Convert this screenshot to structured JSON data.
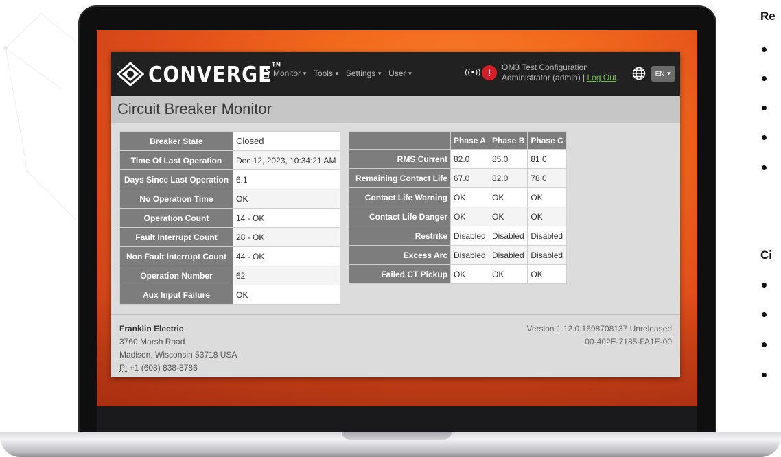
{
  "app": {
    "brand": "CONVERGE",
    "brand_tm": "TM",
    "nav": [
      {
        "label": "Monitor"
      },
      {
        "label": "Tools"
      },
      {
        "label": "Settings"
      },
      {
        "label": "User"
      }
    ],
    "config_name": "OM3 Test Configuration",
    "user_text": "Administrator (admin) |",
    "logout_label": "Log Out",
    "language": "EN",
    "accent_colors": {
      "navbar": "#212121",
      "alert": "#d51f26",
      "logout_link": "#6cc04a",
      "header_cell": "#7d7d7d"
    }
  },
  "page": {
    "title": "Circuit Breaker Monitor"
  },
  "breaker_table": {
    "rows": [
      {
        "label": "Breaker State",
        "value": "Closed"
      },
      {
        "label": "Time Of Last Operation",
        "value": "Dec 12, 2023, 10:34:21 AM"
      },
      {
        "label": "Days Since Last Operation",
        "value": "6.1"
      },
      {
        "label": "No Operation Time",
        "value": "OK"
      },
      {
        "label": "Operation Count",
        "value": "14 - OK"
      },
      {
        "label": "Fault Interrupt Count",
        "value": "28 - OK"
      },
      {
        "label": "Non Fault Interrupt Count",
        "value": "44 - OK"
      },
      {
        "label": "Operation Number",
        "value": "62"
      },
      {
        "label": "Aux Input Failure",
        "value": "OK"
      }
    ]
  },
  "phase_table": {
    "headers": [
      "Phase A",
      "Phase B",
      "Phase C"
    ],
    "rows": [
      {
        "label": "RMS Current",
        "values": [
          "82.0",
          "85.0",
          "81.0"
        ]
      },
      {
        "label": "Remaining Contact Life",
        "values": [
          "67.0",
          "82.0",
          "78.0"
        ]
      },
      {
        "label": "Contact Life Warning",
        "values": [
          "OK",
          "OK",
          "OK"
        ]
      },
      {
        "label": "Contact Life Danger",
        "values": [
          "OK",
          "OK",
          "OK"
        ]
      },
      {
        "label": "Restrike",
        "values": [
          "Disabled",
          "Disabled",
          "Disabled"
        ]
      },
      {
        "label": "Excess Arc",
        "values": [
          "Disabled",
          "Disabled",
          "Disabled"
        ]
      },
      {
        "label": "Failed CT Pickup",
        "values": [
          "OK",
          "OK",
          "OK"
        ]
      }
    ]
  },
  "footer": {
    "company": "Franklin Electric",
    "address1": "3760 Marsh Road",
    "address2": "Madison, Wisconsin 53718 USA",
    "phone_prefix": "P:",
    "phone": " +1 (608) 838-8786",
    "version": "Version 1.12.0.1698708137 Unreleased",
    "device_id": "00-402E-7185-FA1E-00"
  },
  "side_page": {
    "heading1": "Re",
    "heading2": "Ci"
  },
  "icons": [
    "converge-logo-icon",
    "home-icon",
    "radio-signal-icon",
    "alert-icon",
    "globe-icon"
  ]
}
